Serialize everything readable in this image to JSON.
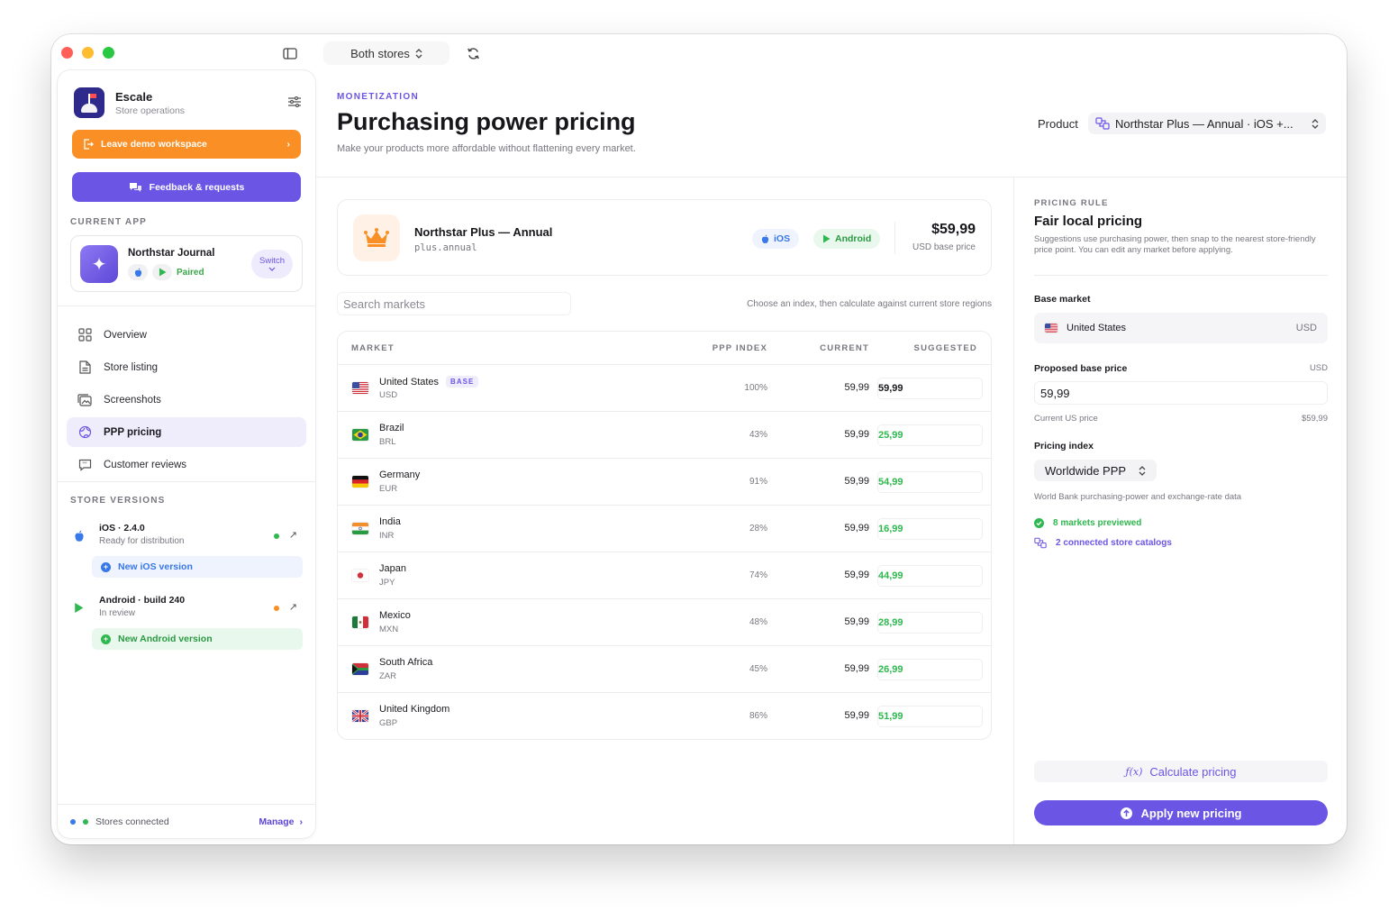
{
  "titlebar": {
    "store_selector": "Both stores"
  },
  "sidebar": {
    "brand_name": "Escale",
    "brand_sub": "Store operations",
    "leave_label": "Leave demo workspace",
    "feedback_label": "Feedback & requests",
    "current_app_label": "CURRENT APP",
    "app_name": "Northstar Journal",
    "app_status": "Paired",
    "switch_label": "Switch",
    "nav": [
      {
        "label": "Overview",
        "icon": "grid-icon"
      },
      {
        "label": "Store listing",
        "icon": "document-icon"
      },
      {
        "label": "Screenshots",
        "icon": "images-icon"
      },
      {
        "label": "PPP pricing",
        "icon": "globe-icon",
        "active": true
      },
      {
        "label": "Customer reviews",
        "icon": "chat-icon"
      }
    ],
    "store_versions_label": "STORE VERSIONS",
    "versions": [
      {
        "title": "iOS · 2.4.0",
        "sub": "Ready for distribution",
        "dot_color": "#2fb84f",
        "button": "New iOS version"
      },
      {
        "title": "Android · build 240",
        "sub": "In review",
        "dot_color": "#fa8f25",
        "button": "New Android version"
      }
    ],
    "footer_status": "Stores connected",
    "footer_manage": "Manage"
  },
  "header": {
    "eyebrow": "MONETIZATION",
    "title": "Purchasing power pricing",
    "subtitle": "Make your products more affordable without flattening every market.",
    "product_label": "Product",
    "product_value": "Northstar Plus — Annual · iOS +..."
  },
  "product_card": {
    "name": "Northstar Plus — Annual",
    "id": "plus.annual",
    "ios_label": "iOS",
    "android_label": "Android",
    "price": "$59,99",
    "price_sub": "USD base price"
  },
  "search": {
    "placeholder": "Search markets",
    "hint": "Choose an index, then calculate against current store regions"
  },
  "table": {
    "headers": {
      "market": "MARKET",
      "ppp": "PPP INDEX",
      "current": "CURRENT",
      "suggested": "SUGGESTED"
    },
    "base_tag": "BASE",
    "rows": [
      {
        "market": "United States",
        "currency": "USD",
        "ppp": "100%",
        "current": "59,99",
        "suggested": "59,99",
        "flag": "us",
        "base": true
      },
      {
        "market": "Brazil",
        "currency": "BRL",
        "ppp": "43%",
        "current": "59,99",
        "suggested": "25,99",
        "flag": "br"
      },
      {
        "market": "Germany",
        "currency": "EUR",
        "ppp": "91%",
        "current": "59,99",
        "suggested": "54,99",
        "flag": "de"
      },
      {
        "market": "India",
        "currency": "INR",
        "ppp": "28%",
        "current": "59,99",
        "suggested": "16,99",
        "flag": "in"
      },
      {
        "market": "Japan",
        "currency": "JPY",
        "ppp": "74%",
        "current": "59,99",
        "suggested": "44,99",
        "flag": "jp"
      },
      {
        "market": "Mexico",
        "currency": "MXN",
        "ppp": "48%",
        "current": "59,99",
        "suggested": "28,99",
        "flag": "mx"
      },
      {
        "market": "South Africa",
        "currency": "ZAR",
        "ppp": "45%",
        "current": "59,99",
        "suggested": "26,99",
        "flag": "za"
      },
      {
        "market": "United Kingdom",
        "currency": "GBP",
        "ppp": "86%",
        "current": "59,99",
        "suggested": "51,99",
        "flag": "gb"
      }
    ]
  },
  "rule_panel": {
    "label": "PRICING RULE",
    "title": "Fair local pricing",
    "description": "Suggestions use purchasing power, then snap to the nearest store-friendly price point. You can edit any market before applying.",
    "base_market_label": "Base market",
    "base_market_value": "United States",
    "base_market_currency": "USD",
    "proposed_label": "Proposed base price",
    "proposed_currency": "USD",
    "proposed_value": "59,99",
    "current_us_label": "Current US price",
    "current_us_value": "$59,99",
    "index_label": "Pricing index",
    "index_value": "Worldwide PPP",
    "index_desc": "World Bank purchasing-power and exchange-rate data",
    "markets_previewed": "8 markets previewed",
    "catalogs": "2 connected store catalogs",
    "calculate_label": "Calculate pricing",
    "apply_label": "Apply new pricing"
  },
  "colors": {
    "accent": "#6b55e5",
    "orange": "#fa8f25",
    "green": "#2fb84f"
  }
}
